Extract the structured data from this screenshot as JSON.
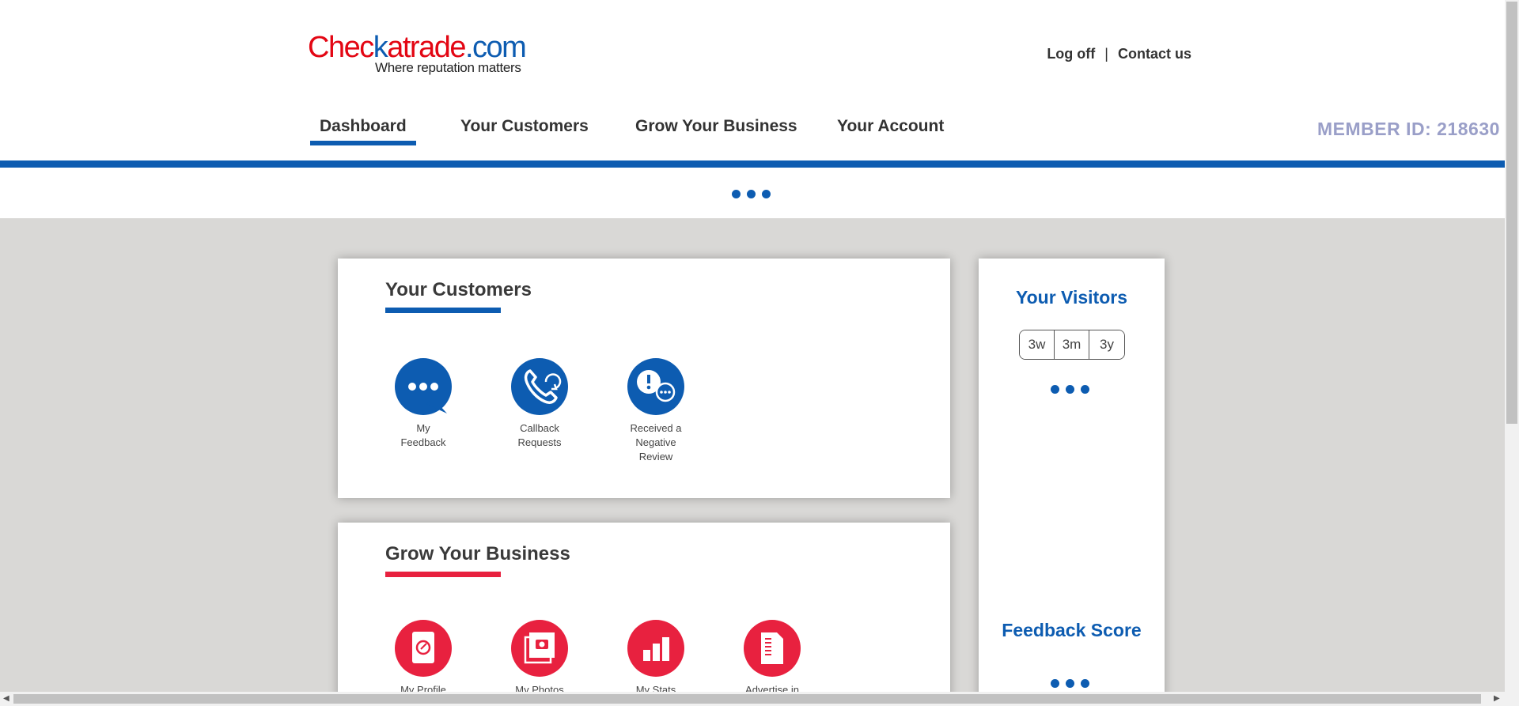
{
  "header": {
    "logo": {
      "part_red_1": "Chec",
      "part_red_2": "k",
      "part_red_3": "atrade",
      "part_blue": ".com",
      "tagline": "Where reputation matters"
    },
    "links": {
      "logoff": "Log off",
      "separator": "|",
      "contact": "Contact us"
    },
    "nav": [
      {
        "label": "Dashboard",
        "active": true
      },
      {
        "label": "Your Customers"
      },
      {
        "label": "Grow Your Business"
      },
      {
        "label": "Your Account"
      }
    ],
    "member_id": "MEMBER ID: 218630"
  },
  "colors": {
    "brand_blue": "#0d5cb1",
    "brand_red": "#e8213f",
    "member_id": "#9a9fc8",
    "page_bg": "#d9d8d6"
  },
  "customers_card": {
    "title": "Your Customers",
    "tiles": [
      {
        "label_line1": "My",
        "label_line2": "Feedback",
        "icon": "speech-bubble-icon"
      },
      {
        "label_line1": "Callback",
        "label_line2": "Requests",
        "icon": "phone-callback-icon"
      },
      {
        "label_line1": "Received a",
        "label_line2": "Negative",
        "label_line3": "Review",
        "icon": "alert-chat-icon"
      }
    ]
  },
  "grow_card": {
    "title": "Grow Your Business",
    "tiles": [
      {
        "label": "My Profile",
        "icon": "profile-card-icon"
      },
      {
        "label": "My Photos",
        "icon": "photos-icon"
      },
      {
        "label": "My Stats",
        "icon": "bar-chart-icon"
      },
      {
        "label": "Advertise in",
        "icon": "directory-icon"
      }
    ]
  },
  "visitors": {
    "title": "Your Visitors",
    "ranges": [
      "3w",
      "3m",
      "3y"
    ]
  },
  "feedback_score": {
    "title": "Feedback Score"
  }
}
